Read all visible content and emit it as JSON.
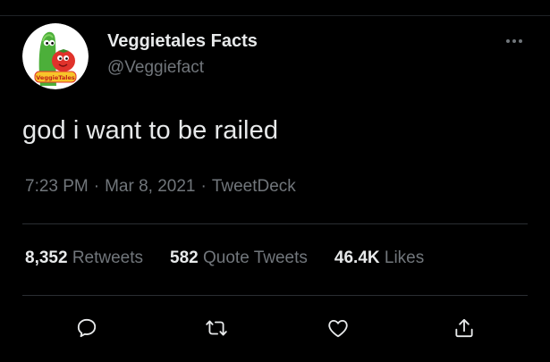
{
  "tweet": {
    "display_name": "Veggietales Facts",
    "handle": "@Veggiefact",
    "text": "god i want to be railed",
    "time": "7:23 PM",
    "date": "Mar 8, 2021",
    "source": "TweetDeck",
    "separator": "·"
  },
  "stats": {
    "retweets": {
      "count": "8,352",
      "label": "Retweets"
    },
    "quotes": {
      "count": "582",
      "label": "Quote Tweets"
    },
    "likes": {
      "count": "46.4K",
      "label": "Likes"
    }
  },
  "avatar": {
    "logo_text": "VeggieTales"
  },
  "icons": {
    "more": "more-horizontal-icon",
    "reply": "reply-icon",
    "retweet": "retweet-icon",
    "like": "heart-icon",
    "share": "share-icon"
  },
  "colors": {
    "background": "#000000",
    "text_primary": "#e7e9ea",
    "text_secondary": "#71767b",
    "divider": "#2a2e32",
    "avatar_bg": "#ffffff",
    "cucumber_green": "#4caf3a",
    "tomato_red": "#e0322b"
  }
}
